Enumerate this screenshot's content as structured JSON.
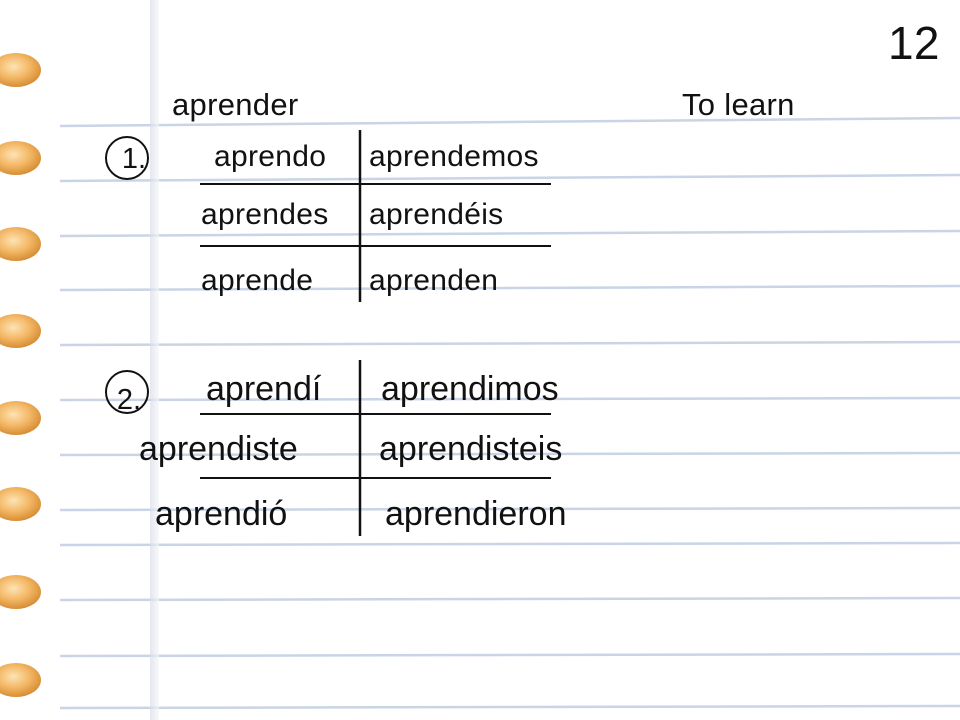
{
  "slide_number": "12",
  "verb": {
    "infinitive": "aprender",
    "translation": "To learn"
  },
  "sections": [
    {
      "number": "1.",
      "forms": [
        "aprendo",
        "aprendemos",
        "aprendes",
        "aprendéis",
        "aprende",
        "aprenden"
      ]
    },
    {
      "number": "2.",
      "forms": [
        "aprendí",
        "aprendimos",
        "aprendiste",
        "aprendisteis",
        "aprendió",
        "aprendieron"
      ]
    }
  ],
  "colors": {
    "ruled_line": "#c9d4e6",
    "margin_dot": "#f1b25e",
    "ink": "#111111"
  }
}
